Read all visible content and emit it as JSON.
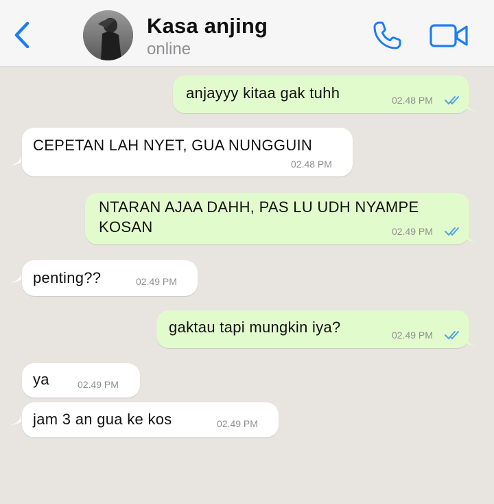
{
  "header": {
    "contact_name": "Kasa anjing",
    "status": "online",
    "back_icon": "chevron-left-icon",
    "call_icon": "phone-icon",
    "video_icon": "video-camera-icon",
    "accent_color": "#1a7ef5"
  },
  "messages": [
    {
      "direction": "outgoing",
      "text": "anjayyy kitaa gak tuhh",
      "time": "02.48 PM",
      "read": true
    },
    {
      "direction": "incoming",
      "text": "CEPETAN LAH NYET, GUA NUNGGUIN",
      "time": "02.48 PM"
    },
    {
      "direction": "outgoing",
      "text_line1": "NTARAN AJAA DAHH, PAS LU UDH NYAMPE",
      "text_line2": "KOSAN",
      "time": "02.49 PM",
      "read": true
    },
    {
      "direction": "incoming",
      "text": "penting??",
      "time": "02.49 PM"
    },
    {
      "direction": "outgoing",
      "text": "gaktau tapi mungkin iya?",
      "time": "02.49 PM",
      "read": true
    },
    {
      "direction": "incoming",
      "text": "ya",
      "time": "02.49 PM"
    },
    {
      "direction": "incoming",
      "text": "jam 3 an gua ke kos",
      "time": "02.49 PM"
    }
  ],
  "colors": {
    "outgoing_bubble": "#e2fbcc",
    "incoming_bubble": "#ffffff",
    "chat_background": "#e8e5e0",
    "read_ticks": "#4fa3e0"
  }
}
